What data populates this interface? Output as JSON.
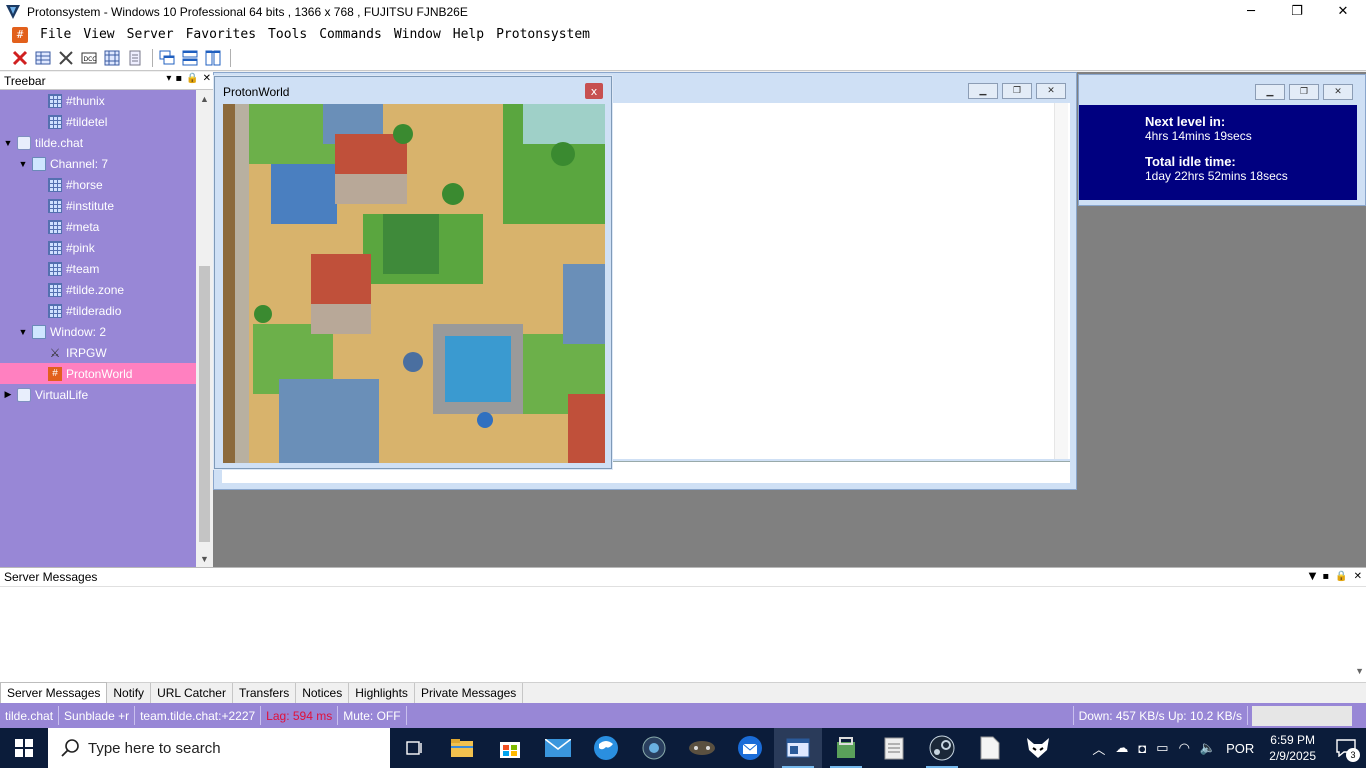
{
  "window": {
    "title": "Protonsystem - Windows 10 Professional 64 bits , 1366 x 768 , FUJITSU FJNB26E",
    "minimize": "─",
    "restore": "❐",
    "close": "✕"
  },
  "menu": {
    "icon_glyph": "#",
    "items": [
      "File",
      "View",
      "Server",
      "Favorites",
      "Tools",
      "Commands",
      "Window",
      "Help",
      "Protonsystem"
    ]
  },
  "treebar": {
    "title": "Treebar",
    "controls": [
      "▾",
      "▪",
      "🔒",
      "✕"
    ],
    "rows": [
      {
        "label": "#thunix",
        "type": "channel",
        "indent": 3
      },
      {
        "label": "#tildetel",
        "type": "channel",
        "indent": 3
      },
      {
        "label": "tilde.chat",
        "type": "server",
        "indent": 0,
        "expander": "▼"
      },
      {
        "label": "Channel: 7",
        "type": "folder",
        "indent": 1,
        "expander": "▼"
      },
      {
        "label": "#horse",
        "type": "channel",
        "indent": 3
      },
      {
        "label": "#institute",
        "type": "channel",
        "indent": 3
      },
      {
        "label": "#meta",
        "type": "channel",
        "indent": 3
      },
      {
        "label": "#pink",
        "type": "channel",
        "indent": 3
      },
      {
        "label": "#team",
        "type": "channel",
        "indent": 3
      },
      {
        "label": "#tilde.zone",
        "type": "channel",
        "indent": 3
      },
      {
        "label": "#tilderadio",
        "type": "channel",
        "indent": 3
      },
      {
        "label": "Window: 2",
        "type": "folder",
        "indent": 1,
        "expander": "▼"
      },
      {
        "label": "IRPGW",
        "type": "swords",
        "indent": 3
      },
      {
        "label": "ProtonWorld",
        "type": "hash",
        "indent": 3,
        "selected": true
      },
      {
        "label": "VirtualLife",
        "type": "server",
        "indent": 0,
        "expander": "▶"
      }
    ]
  },
  "idle_window": {
    "next_level_label": "Next level in:",
    "next_level_value": "4hrs 14mins 19secs",
    "total_idle_label": "Total idle time:",
    "total_idle_value": "1day 22hrs 52mins 18secs"
  },
  "protonworld": {
    "title": "ProtonWorld",
    "close": "x"
  },
  "server_messages": {
    "title": "Server Messages"
  },
  "tabs": [
    "Server Messages",
    "Notify",
    "URL Catcher",
    "Transfers",
    "Notices",
    "Highlights",
    "Private Messages"
  ],
  "status": {
    "network": "tilde.chat",
    "nick": "Sunblade +r",
    "channel": "team.tilde.chat:+2227",
    "lag": "Lag: 594 ms",
    "mute": "Mute: OFF",
    "transfer": "Down: 457 KB/s Up: 10.2 KB/s"
  },
  "taskbar": {
    "search_placeholder": "Type here to search",
    "language": "POR",
    "time": "6:59 PM",
    "date": "2/9/2025",
    "notifications": "3"
  },
  "colors": {
    "treebar_bg": "#9887d6",
    "selected_bg": "#ff80c0",
    "idle_panel": "#000080",
    "lag_text": "#e0103a"
  }
}
